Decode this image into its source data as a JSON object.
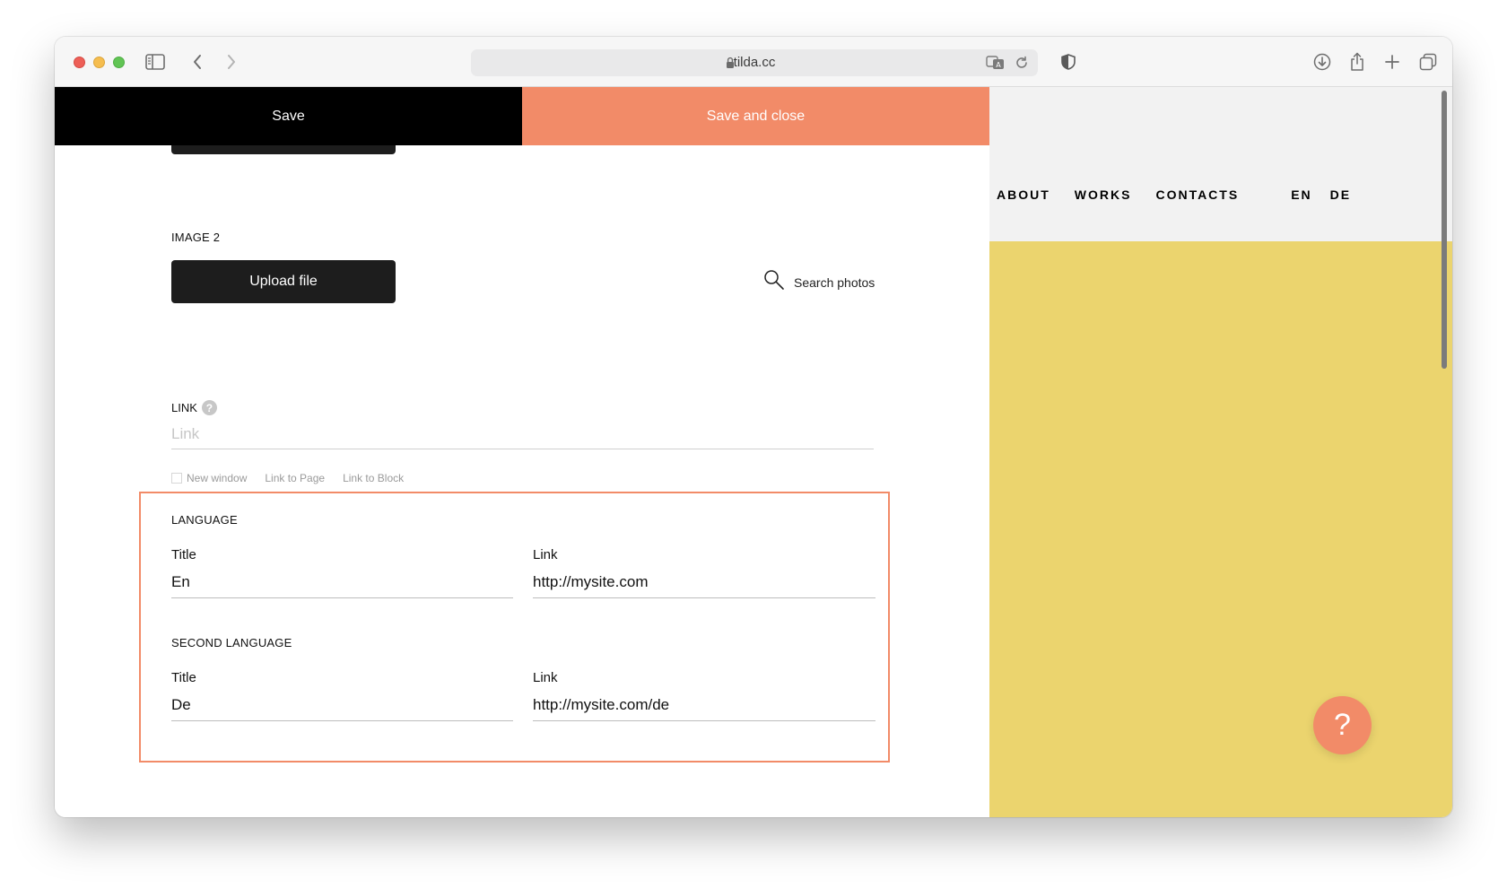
{
  "browser": {
    "url": "tilda.cc"
  },
  "savebar": {
    "save_label": "Save",
    "save_close_label": "Save and close"
  },
  "image2": {
    "label": "IMAGE 2",
    "upload_label": "Upload file",
    "search_label": "Search photos"
  },
  "link": {
    "label": "LINK",
    "help": "?",
    "placeholder": "Link",
    "value": "",
    "options": [
      "New window",
      "Link to Page",
      "Link to Block"
    ]
  },
  "language": {
    "label": "LANGUAGE",
    "title_label": "Title",
    "title_value": "En",
    "link_label": "Link",
    "link_value": "http://mysite.com"
  },
  "second_language": {
    "label": "SECOND LANGUAGE",
    "title_label": "Title",
    "title_value": "De",
    "link_label": "Link",
    "link_value": "http://mysite.com/de"
  },
  "preview": {
    "nav": [
      "ABOUT",
      "WORKS",
      "CONTACTS"
    ],
    "langs": [
      "EN",
      "DE"
    ],
    "background_color": "#ebd46e",
    "header_color": "#f2f2f2"
  },
  "help_fab": {
    "label": "?"
  },
  "colors": {
    "accent": "#f28b68",
    "dark": "#1d1d1d"
  }
}
